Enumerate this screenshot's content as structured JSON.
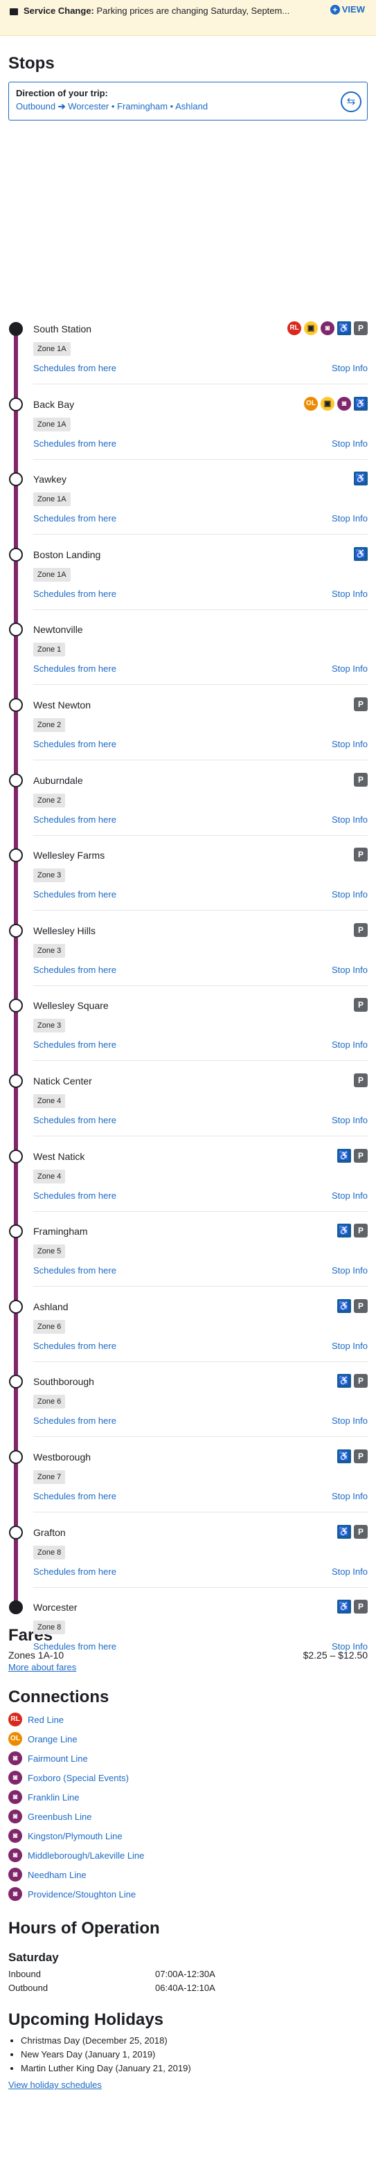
{
  "alert": {
    "title": "Service Change:",
    "text": "Parking prices are changing Saturday, Septem...",
    "view_label": "VIEW"
  },
  "stops_section": {
    "heading": "Stops",
    "direction_label": "Direction of your trip:",
    "origin": "Outbound",
    "dest": "Worcester",
    "via1": "Framingham",
    "via2": "Ashland"
  },
  "common": {
    "schedules_label": "Schedules from here",
    "info_label": "Stop Info"
  },
  "stops": [
    {
      "name": "South Station",
      "zone": "Zone 1A",
      "terminal": true,
      "icons": [
        "RL",
        "bus",
        "CR",
        "acc",
        "P"
      ]
    },
    {
      "name": "Back Bay",
      "zone": "Zone 1A",
      "terminal": false,
      "icons": [
        "OL",
        "bus",
        "CR",
        "acc"
      ]
    },
    {
      "name": "Yawkey",
      "zone": "Zone 1A",
      "terminal": false,
      "icons": [
        "acc"
      ]
    },
    {
      "name": "Boston Landing",
      "zone": "Zone 1A",
      "terminal": false,
      "icons": [
        "acc"
      ]
    },
    {
      "name": "Newtonville",
      "zone": "Zone 1",
      "terminal": false,
      "icons": []
    },
    {
      "name": "West Newton",
      "zone": "Zone 2",
      "terminal": false,
      "icons": [
        "P"
      ]
    },
    {
      "name": "Auburndale",
      "zone": "Zone 2",
      "terminal": false,
      "icons": [
        "P"
      ]
    },
    {
      "name": "Wellesley Farms",
      "zone": "Zone 3",
      "terminal": false,
      "icons": [
        "P"
      ]
    },
    {
      "name": "Wellesley Hills",
      "zone": "Zone 3",
      "terminal": false,
      "icons": [
        "P"
      ]
    },
    {
      "name": "Wellesley Square",
      "zone": "Zone 3",
      "terminal": false,
      "icons": [
        "P"
      ]
    },
    {
      "name": "Natick Center",
      "zone": "Zone 4",
      "terminal": false,
      "icons": [
        "P"
      ]
    },
    {
      "name": "West Natick",
      "zone": "Zone 4",
      "terminal": false,
      "icons": [
        "acc",
        "P"
      ]
    },
    {
      "name": "Framingham",
      "zone": "Zone 5",
      "terminal": false,
      "icons": [
        "acc",
        "P"
      ]
    },
    {
      "name": "Ashland",
      "zone": "Zone 6",
      "terminal": false,
      "icons": [
        "acc",
        "P"
      ]
    },
    {
      "name": "Southborough",
      "zone": "Zone 6",
      "terminal": false,
      "icons": [
        "acc",
        "P"
      ]
    },
    {
      "name": "Westborough",
      "zone": "Zone 7",
      "terminal": false,
      "icons": [
        "acc",
        "P"
      ]
    },
    {
      "name": "Grafton",
      "zone": "Zone 8",
      "terminal": false,
      "icons": [
        "acc",
        "P"
      ]
    },
    {
      "name": "Worcester",
      "zone": "Zone 8",
      "terminal": true,
      "icons": [
        "acc",
        "P"
      ]
    }
  ],
  "icon_labels": {
    "RL": "RL",
    "OL": "OL",
    "bus": "▣",
    "CR": "◙",
    "acc": "♿",
    "P": "P"
  },
  "fares": {
    "heading": "Fares",
    "zones": "Zones 1A-10",
    "range": "$2.25 – $12.50",
    "more": "More about fares"
  },
  "connections": {
    "heading": "Connections",
    "items": [
      {
        "icon": "RL",
        "label": "Red Line"
      },
      {
        "icon": "OL",
        "label": "Orange Line"
      },
      {
        "icon": "CR",
        "label": "Fairmount Line"
      },
      {
        "icon": "CR",
        "label": "Foxboro (Special Events)"
      },
      {
        "icon": "CR",
        "label": "Franklin Line"
      },
      {
        "icon": "CR",
        "label": "Greenbush Line"
      },
      {
        "icon": "CR",
        "label": "Kingston/Plymouth Line"
      },
      {
        "icon": "CR",
        "label": "Middleborough/Lakeville Line"
      },
      {
        "icon": "CR",
        "label": "Needham Line"
      },
      {
        "icon": "CR",
        "label": "Providence/Stoughton Line"
      }
    ]
  },
  "hours": {
    "heading": "Hours of Operation",
    "day": "Saturday",
    "inbound_label": "Inbound",
    "inbound": "07:00A-12:30A",
    "outbound_label": "Outbound",
    "outbound": "06:40A-12:10A"
  },
  "holidays": {
    "heading": "Upcoming Holidays",
    "items": [
      "Christmas Day (December 25, 2018)",
      "New Years Day (January 1, 2019)",
      "Martin Luther King Day (January 21, 2019)"
    ],
    "link": "View holiday schedules"
  },
  "colors": {
    "line": "#80276c",
    "link": "#1c6ac5",
    "red_line": "#da291c",
    "orange_line": "#ed8b00"
  }
}
